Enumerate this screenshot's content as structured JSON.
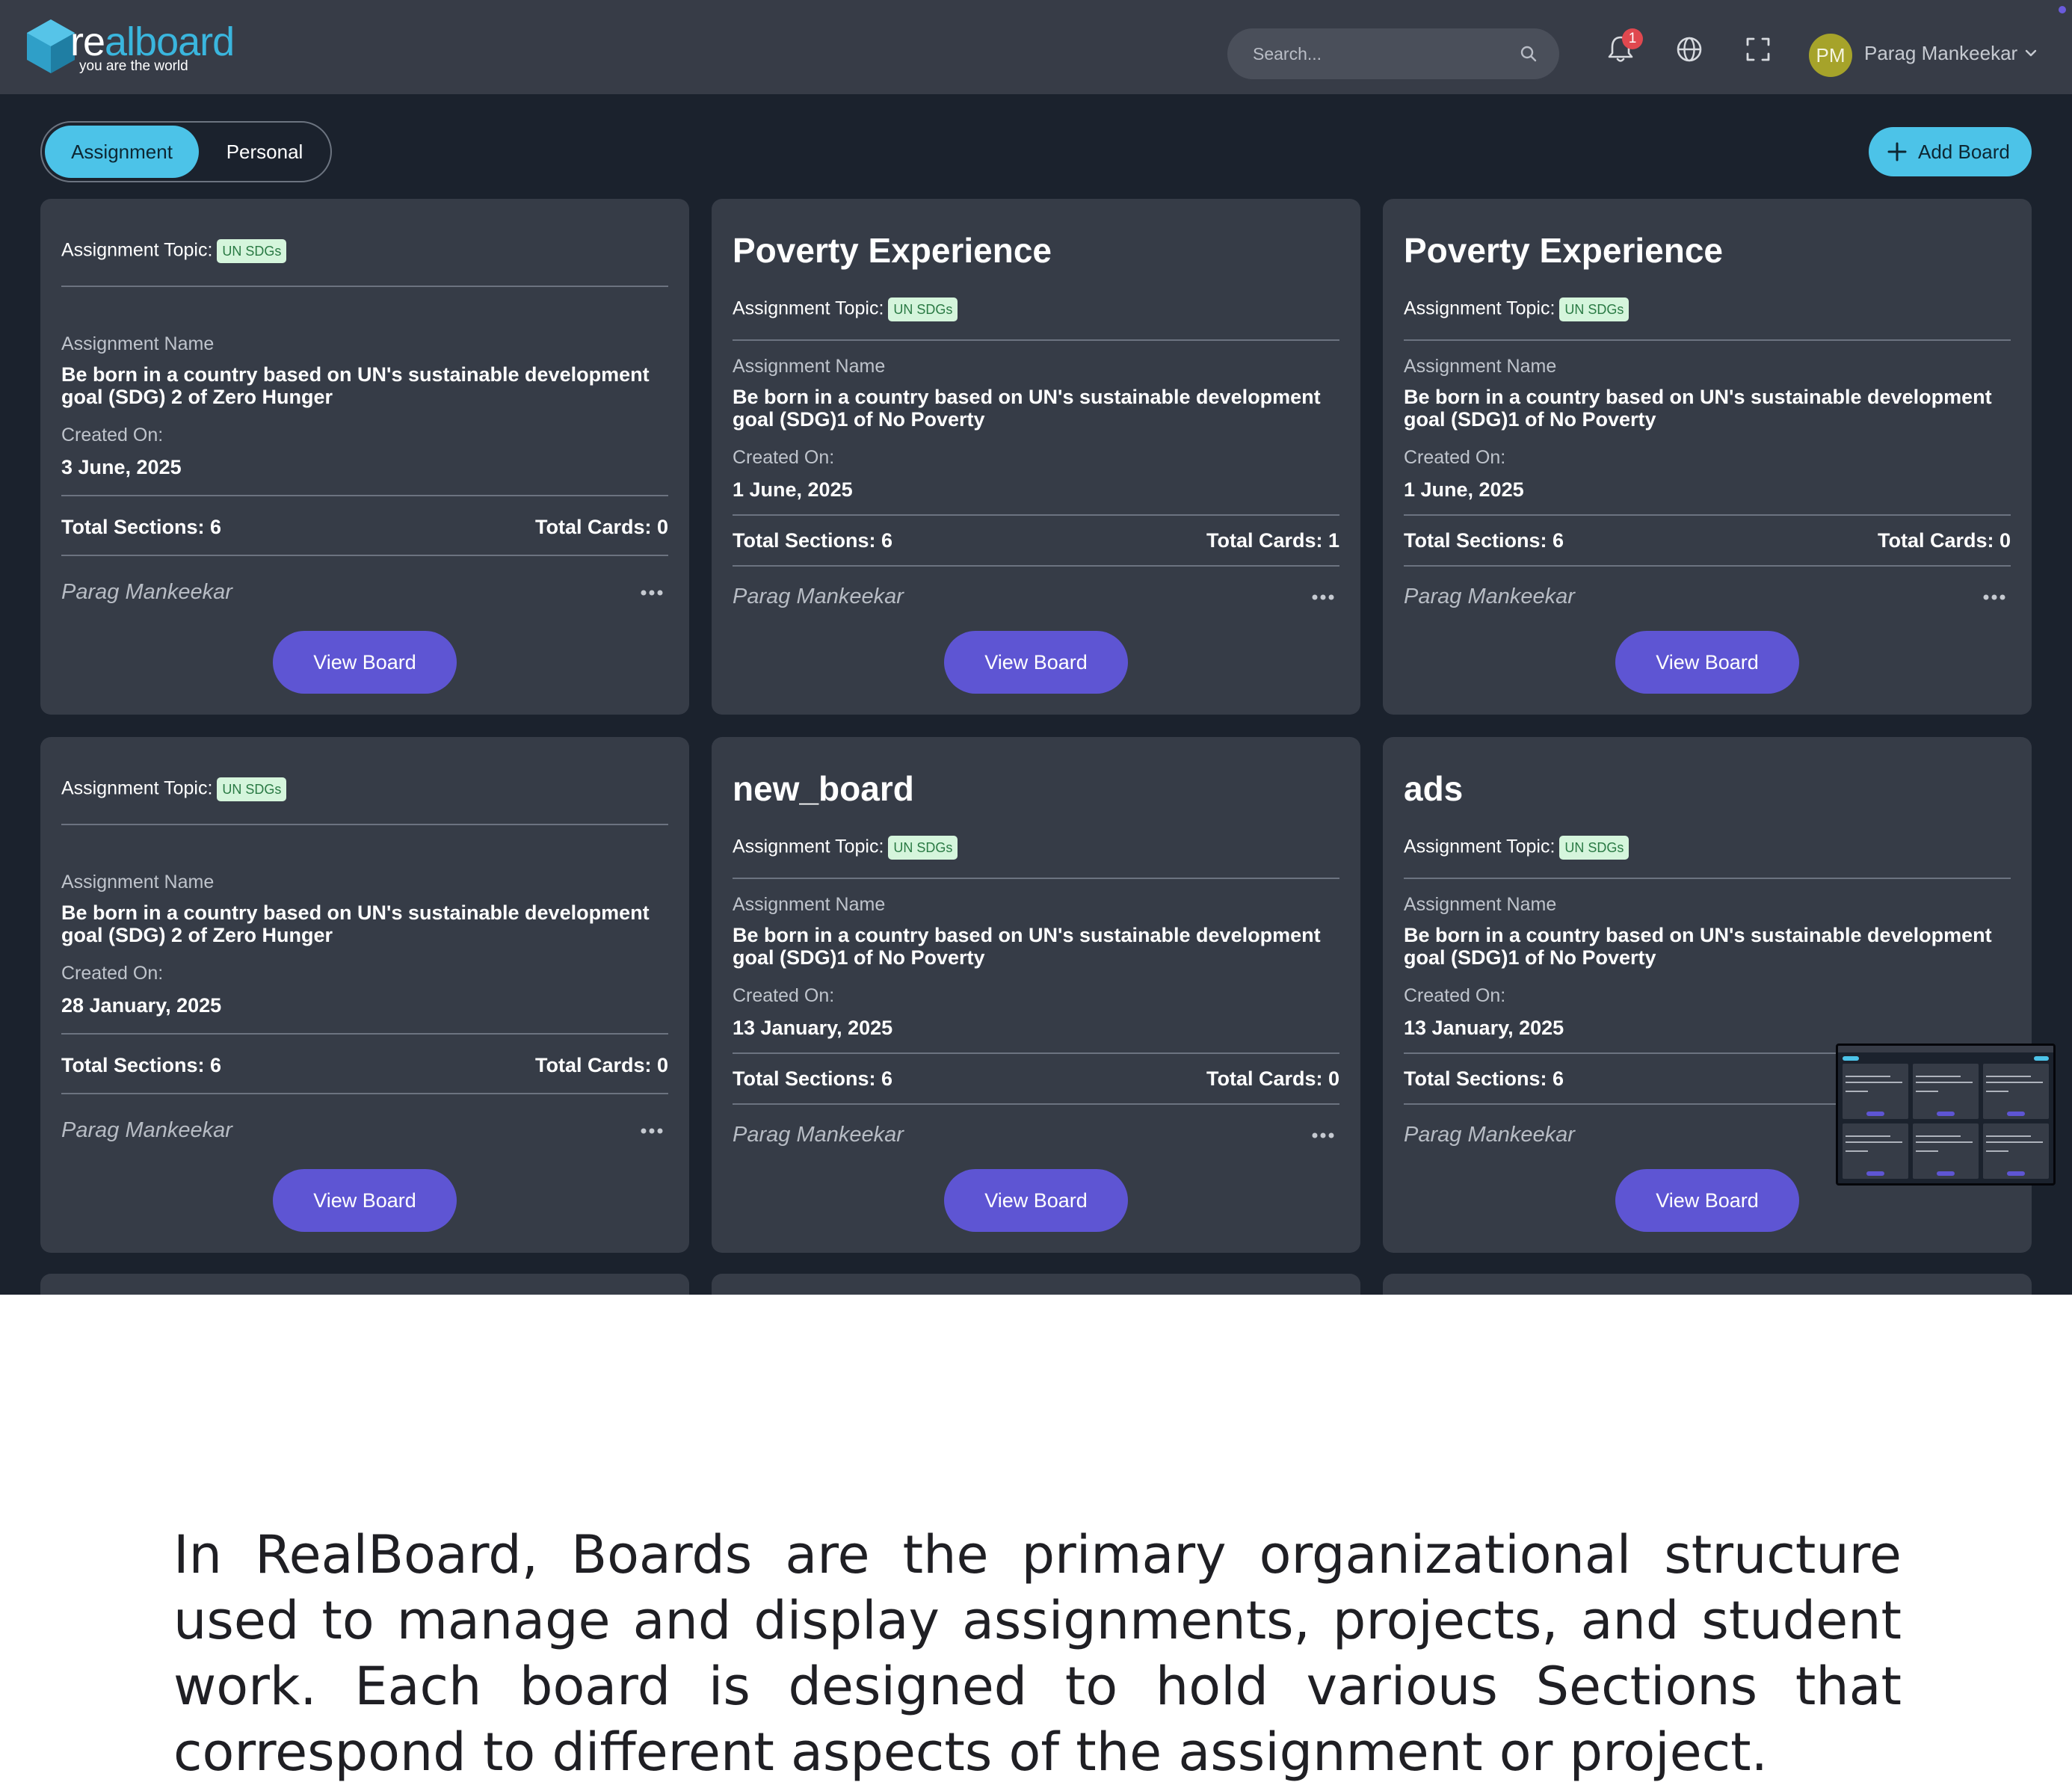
{
  "header": {
    "logo_word_prefix": "re",
    "logo_word_main": "alboard",
    "logo_tagline": "you are the world",
    "search_placeholder": "Search...",
    "notification_count": "1",
    "user_initials": "PM",
    "user_name": "Parag Mankeekar",
    "icons": [
      "search-icon",
      "bell-icon",
      "globe-icon",
      "fullscreen-icon",
      "chevron-down-icon"
    ]
  },
  "tabs": [
    {
      "label": "Assignment",
      "active": true
    },
    {
      "label": "Personal",
      "active": false
    }
  ],
  "add_board_label": "Add Board",
  "labels": {
    "topic": "Assignment Topic:",
    "assignment_name": "Assignment Name",
    "created_on": "Created On:",
    "view_board": "View Board"
  },
  "cards": [
    {
      "title": "",
      "topic_badge": "UN SDGs",
      "assignment_name": "Be born in a country based on UN's sustainable development goal (SDG) 2 of Zero Hunger",
      "created_on": "3 June, 2025",
      "total_sections": "Total Sections: 6",
      "total_cards": "Total Cards: 0",
      "owner": "Parag Mankeekar"
    },
    {
      "title": "Poverty Experience",
      "topic_badge": "UN SDGs",
      "assignment_name": "Be born in a country based on UN's sustainable development goal (SDG)1 of No Poverty",
      "created_on": "1 June, 2025",
      "total_sections": "Total Sections: 6",
      "total_cards": "Total Cards: 1",
      "owner": "Parag Mankeekar"
    },
    {
      "title": "Poverty Experience",
      "topic_badge": "UN SDGs",
      "assignment_name": "Be born in a country based on UN's sustainable development goal (SDG)1 of No Poverty",
      "created_on": "1 June, 2025",
      "total_sections": "Total Sections: 6",
      "total_cards": "Total Cards: 0",
      "owner": "Parag Mankeekar"
    },
    {
      "title": "",
      "topic_badge": "UN SDGs",
      "assignment_name": "Be born in a country based on UN's sustainable development goal (SDG) 2 of Zero Hunger",
      "created_on": "28 January, 2025",
      "total_sections": "Total Sections: 6",
      "total_cards": "Total Cards: 0",
      "owner": "Parag Mankeekar"
    },
    {
      "title": "new_board",
      "topic_badge": "UN SDGs",
      "assignment_name": "Be born in a country based on UN's sustainable development goal (SDG)1 of No Poverty",
      "created_on": "13 January, 2025",
      "total_sections": "Total Sections: 6",
      "total_cards": "Total Cards: 0",
      "owner": "Parag Mankeekar"
    },
    {
      "title": "ads",
      "topic_badge": "UN SDGs",
      "assignment_name": "Be born in a country based on UN's sustainable development goal (SDG)1 of No Poverty",
      "created_on": "13 January, 2025",
      "total_sections": "Total Sections: 6",
      "total_cards": "",
      "owner": "Parag Mankeekar"
    }
  ],
  "caption": "In RealBoard, Boards are the primary  organizational structure used to manage and display assignments,  projects, and student work. Each board is designed to hold various Sections that correspond to different aspects of the assignment or project.",
  "colors": {
    "header_bg": "#373c47",
    "page_bg": "#1b222d",
    "card_bg": "#363c47",
    "accent_cyan": "#4cc3e8",
    "button_purple": "#5e55d3",
    "badge_bg": "#d5f5dc",
    "badge_text": "#2a7a44",
    "notification_red": "#e0484f"
  }
}
